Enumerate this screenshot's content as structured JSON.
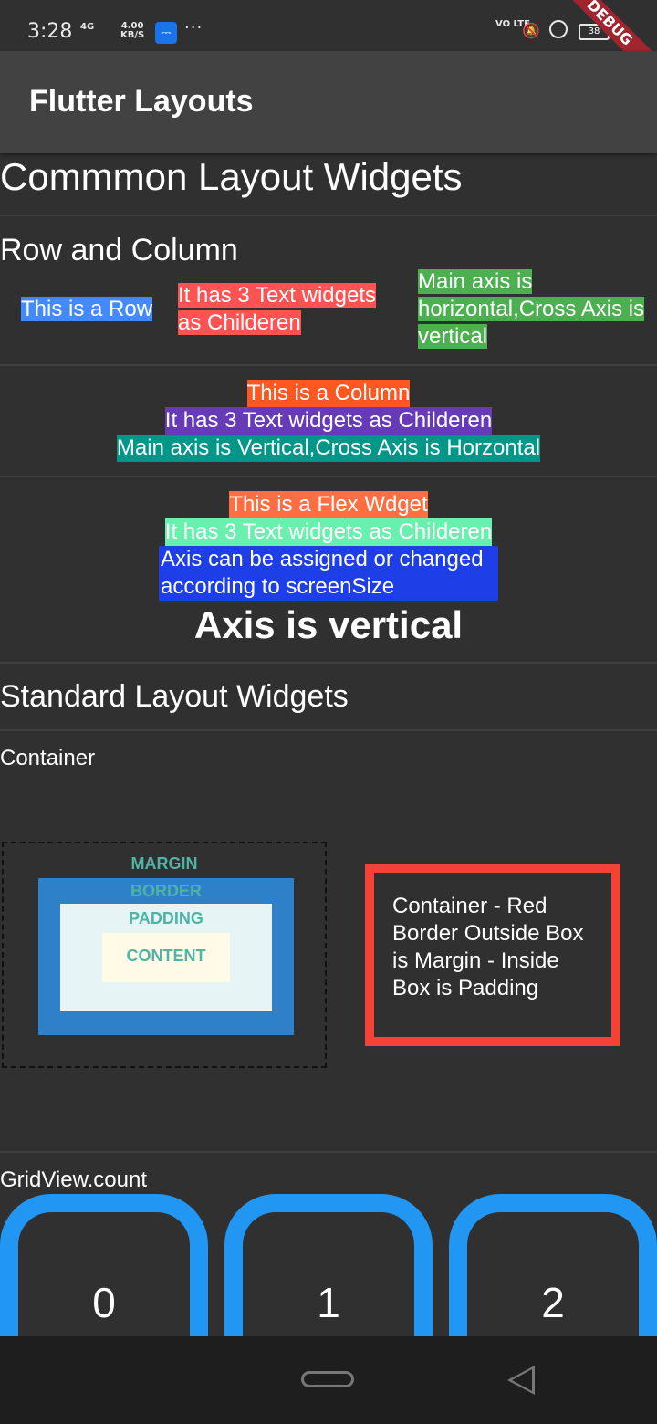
{
  "status_bar": {
    "time": "3:28",
    "network": "4G",
    "speed_value": "4.00",
    "speed_unit": "KB/S",
    "dots": "···",
    "volte": "VO LTE",
    "battery": "38",
    "debug_banner": "DEBUG"
  },
  "app_bar": {
    "title": "Flutter Layouts"
  },
  "sections": {
    "common_title": "Commmon Layout Widgets",
    "row_column_title": "Row and Column",
    "row": {
      "item1": "This is a Row",
      "item2": "It has 3 Text widgets as Childeren",
      "item3": "Main axis is horizontal,Cross Axis is vertical",
      "colors": [
        "#448aff",
        "#ff5252",
        "#4caf50"
      ]
    },
    "column": {
      "item1": "This is a Column",
      "item2": "It has 3 Text widgets as Childeren",
      "item3": "Main axis is Vertical,Cross Axis is Horzontal",
      "colors": [
        "#ff5722",
        "#673ab7",
        "#009688"
      ]
    },
    "flex": {
      "item1": "This is a Flex Wdget",
      "item2": "It has 3 Text widgets as Childeren",
      "item3": "Axis can be assigned or changed according to screenSize",
      "axis_label": "Axis is vertical",
      "colors": [
        "#ff6e40",
        "#69f0ae",
        "#1e3ee8"
      ]
    },
    "standard_title": "Standard Layout Widgets",
    "container_label": "Container",
    "box_model": {
      "margin": "MARGIN",
      "border": "BORDER",
      "padding": "PADDING",
      "content": "CONTENT"
    },
    "container_text": "Container - Red Border Outside Box is Margin - Inside Box is Padding",
    "gridview_label": "GridView.count",
    "grid_items": [
      "0",
      "1",
      "2"
    ]
  },
  "colors": {
    "background": "#303030",
    "app_bar": "#424242",
    "red_border": "#f44336",
    "grid_border": "#2196f3"
  }
}
